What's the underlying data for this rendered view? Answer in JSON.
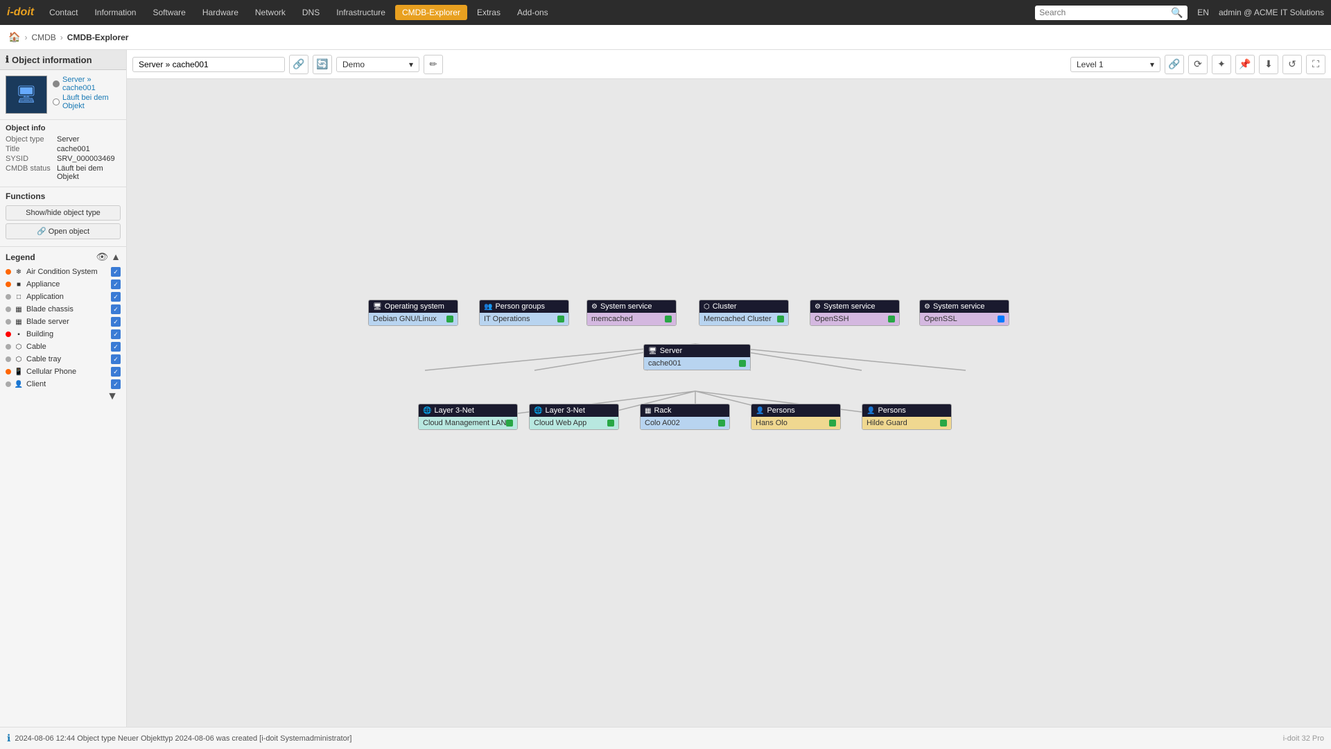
{
  "app": {
    "logo": "i-doit",
    "nav_items": [
      "Contact",
      "Information",
      "Software",
      "Hardware",
      "Network",
      "DNS",
      "Infrastructure",
      "CMDB-Explorer",
      "Extras",
      "Add-ons"
    ],
    "active_nav": "CMDB-Explorer",
    "search_placeholder": "Search",
    "language": "EN",
    "user": "admin @ ACME IT Solutions"
  },
  "breadcrumb": {
    "home_icon": "🏠",
    "items": [
      "CMDB",
      "CMDB-Explorer"
    ]
  },
  "left_panel": {
    "object_info_title": "Object information",
    "server_option_1": "Server »",
    "server_option_1b": "cache001",
    "server_option_2": "Läuft bei dem Objekt",
    "object_info": {
      "title": "Object info",
      "rows": [
        {
          "key": "Object type",
          "val": "Server"
        },
        {
          "key": "Title",
          "val": "cache001"
        },
        {
          "key": "SYSID",
          "val": "SRV_000003469"
        },
        {
          "key": "CMDB status",
          "val": "Läuft bei dem Objekt"
        }
      ]
    },
    "functions": {
      "title": "Functions",
      "buttons": [
        "Show/hide object type",
        "🔗 Open object"
      ]
    },
    "legend": {
      "title": "Legend",
      "items": [
        {
          "dot": "#ff6600",
          "icon": "❄",
          "label": "Air Condition System",
          "checked": true
        },
        {
          "dot": "#ff6600",
          "icon": "■",
          "label": "Appliance",
          "checked": true
        },
        {
          "dot": "#999",
          "icon": "□",
          "label": "Application",
          "checked": true
        },
        {
          "dot": "#999",
          "icon": "▦",
          "label": "Blade chassis",
          "checked": true
        },
        {
          "dot": "#999",
          "icon": "▦",
          "label": "Blade server",
          "checked": true
        },
        {
          "dot": "#ff0000",
          "icon": "▪",
          "label": "Building",
          "checked": true
        },
        {
          "dot": "#999",
          "icon": "⬡",
          "label": "Cable",
          "checked": true
        },
        {
          "dot": "#999",
          "icon": "⬡",
          "label": "Cable tray",
          "checked": true
        },
        {
          "dot": "#ff6600",
          "icon": "📱",
          "label": "Cellular Phone",
          "checked": true
        },
        {
          "dot": "#999",
          "icon": "👤",
          "label": "Client",
          "checked": true
        }
      ]
    }
  },
  "canvas": {
    "search_input": "Server » cache001",
    "preset_value": "Demo",
    "level_value": "Level 1",
    "nodes": {
      "top": [
        {
          "id": "os",
          "type": "Operating system",
          "label": "Debian GNU/Linux",
          "bg": "blue",
          "dot": "green"
        },
        {
          "id": "pg",
          "type": "Person groups",
          "label": "IT Operations",
          "bg": "blue",
          "dot": "green"
        },
        {
          "id": "ss1",
          "type": "System service",
          "label": "memcached",
          "bg": "purple",
          "dot": "green"
        },
        {
          "id": "cl",
          "type": "Cluster",
          "label": "Memcached Cluster",
          "bg": "blue",
          "dot": "green"
        },
        {
          "id": "ss2",
          "type": "System service",
          "label": "OpenSSH",
          "bg": "purple",
          "dot": "green"
        },
        {
          "id": "ss3",
          "type": "System service",
          "label": "OpenSSL",
          "bg": "purple",
          "dot": "blue"
        }
      ],
      "center": {
        "id": "srv",
        "type": "Server",
        "label": "cache001",
        "dot": "green"
      },
      "bottom": [
        {
          "id": "l3n1",
          "type": "Layer 3-Net",
          "label": "Cloud Management LAN",
          "bg": "teal",
          "dot": "green"
        },
        {
          "id": "l3n2",
          "type": "Layer 3-Net",
          "label": "Cloud Web App",
          "bg": "teal",
          "dot": "green"
        },
        {
          "id": "rack",
          "type": "Rack",
          "label": "Colo A002",
          "bg": "blue",
          "dot": "green"
        },
        {
          "id": "p1",
          "type": "Persons",
          "label": "Hans Olo",
          "bg": "orange",
          "dot": "green"
        },
        {
          "id": "p2",
          "type": "Persons",
          "label": "Hilde Guard",
          "bg": "orange",
          "dot": "green"
        }
      ]
    }
  },
  "status_bar": {
    "message": "2024-08-06 12:44  Object type Neuer Objekttyp 2024-08-06 was created [i-doit Systemadministrator]",
    "version": "i-doit 32 Pro"
  }
}
